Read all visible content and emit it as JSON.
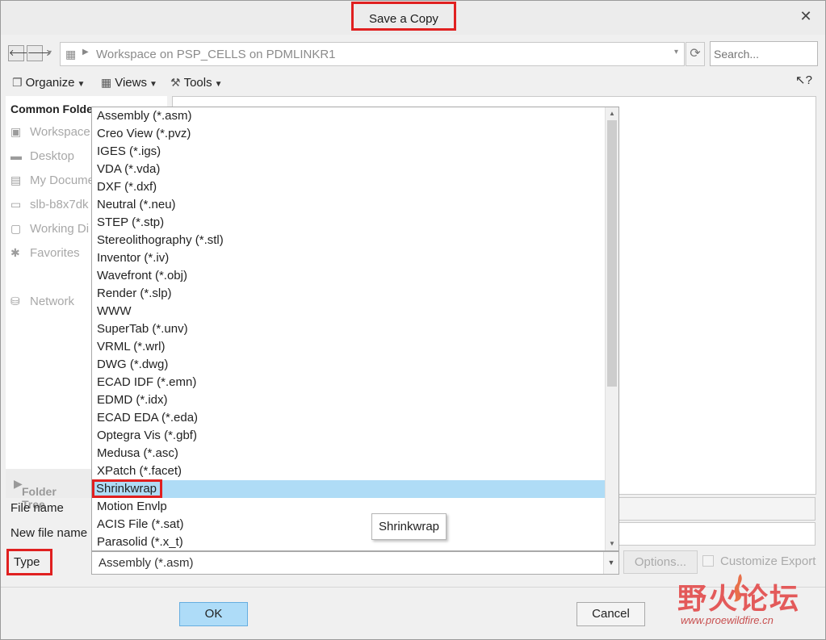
{
  "window": {
    "title": "Save a Copy",
    "close_glyph": "✕"
  },
  "nav": {
    "back_glyph": "🡐",
    "forward_glyph": "🡒",
    "dropdown_glyph": "▾"
  },
  "address": {
    "icon": "workspace-icon",
    "path": "Workspace on PSP_CELLS on PDMLINKR1",
    "dropdown_glyph": "▾",
    "refresh_glyph": "⟳",
    "search_placeholder": "Search..."
  },
  "toolbar": {
    "organize_label": "Organize",
    "views_label": "Views",
    "tools_label": "Tools",
    "chevron": "⌄",
    "help_glyph": "↖?"
  },
  "left_pane": {
    "title": "Common Folde",
    "items": [
      {
        "label": "Workspace",
        "icon": "workspace-icon"
      },
      {
        "label": "Desktop",
        "icon": "desktop-icon"
      },
      {
        "label": "My Docume",
        "icon": "documents-icon"
      },
      {
        "label": "slb-b8x7dk",
        "icon": "computer-icon"
      },
      {
        "label": "Working Di",
        "icon": "folder-icon"
      },
      {
        "label": "Favorites",
        "icon": "star-icon"
      },
      {
        "label": "Network",
        "icon": "network-icon"
      }
    ],
    "folder_tree_label": "Folder Tree"
  },
  "form": {
    "file_name_label": "File name",
    "new_file_name_label": "New file name",
    "type_label": "Type",
    "type_value": "Assembly (*.asm)",
    "type_arrow": "▼",
    "options_label": "Options...",
    "customize_export_label": "Customize Export",
    "ok_label": "OK",
    "cancel_label": "Cancel"
  },
  "type_dropdown": {
    "selected_index": 21,
    "options": [
      "Assembly (*.asm)",
      "Creo View (*.pvz)",
      "IGES (*.igs)",
      "VDA (*.vda)",
      "DXF (*.dxf)",
      "Neutral (*.neu)",
      "STEP (*.stp)",
      "Stereolithography (*.stl)",
      "Inventor (*.iv)",
      "Wavefront (*.obj)",
      "Render (*.slp)",
      "WWW",
      "SuperTab (*.unv)",
      "VRML (*.wrl)",
      "DWG (*.dwg)",
      "ECAD IDF (*.emn)",
      "EDMD (*.idx)",
      "ECAD EDA (*.eda)",
      "Optegra Vis (*.gbf)",
      "Medusa (*.asc)",
      "XPatch (*.facet)",
      "Shrinkwrap",
      "Motion Envlp",
      "ACIS File (*.sat)",
      "Parasolid (*.x_t)"
    ],
    "tooltip": "Shrinkwrap"
  },
  "watermark": {
    "chinese": "野火论坛",
    "url": "www.proewildfire.cn"
  },
  "colors": {
    "highlight": "#afdcf6",
    "annotation_red": "#e02020",
    "ok_button": "#aedcf8"
  }
}
